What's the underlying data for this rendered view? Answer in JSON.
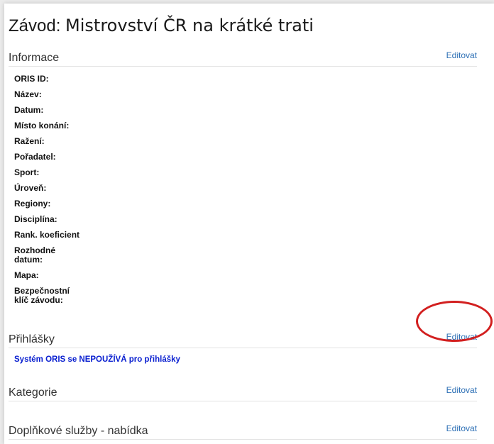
{
  "page": {
    "title_label": "Závod:",
    "title_name": "Mistrovství ČR na krátké trati"
  },
  "sections": {
    "informace": {
      "title": "Informace",
      "edit_label": "Editovat",
      "fields": [
        "ORIS ID:",
        "Název:",
        "Datum:",
        "Místo konání:",
        "Ražení:",
        "Pořadatel:",
        "Sport:",
        "Úroveň:",
        "Regiony:",
        "Disciplína:",
        "Rank. koeficient",
        "Rozhodné datum:",
        "Mapa:",
        "Bezpečnostní klíč závodu:"
      ]
    },
    "prihlasky": {
      "title": "Přihlášky",
      "edit_label": "Editovat",
      "note": "Systém ORIS se NEPOUŽÍVÁ pro přihlášky"
    },
    "kategorie": {
      "title": "Kategorie",
      "edit_label": "Editovat"
    },
    "doplnkove": {
      "title": "Doplňkové služby - nabídka",
      "edit_label": "Editovat"
    }
  },
  "colors": {
    "link": "#2c6fb5",
    "note": "#0a20d0",
    "annotation": "#d21f1f"
  }
}
